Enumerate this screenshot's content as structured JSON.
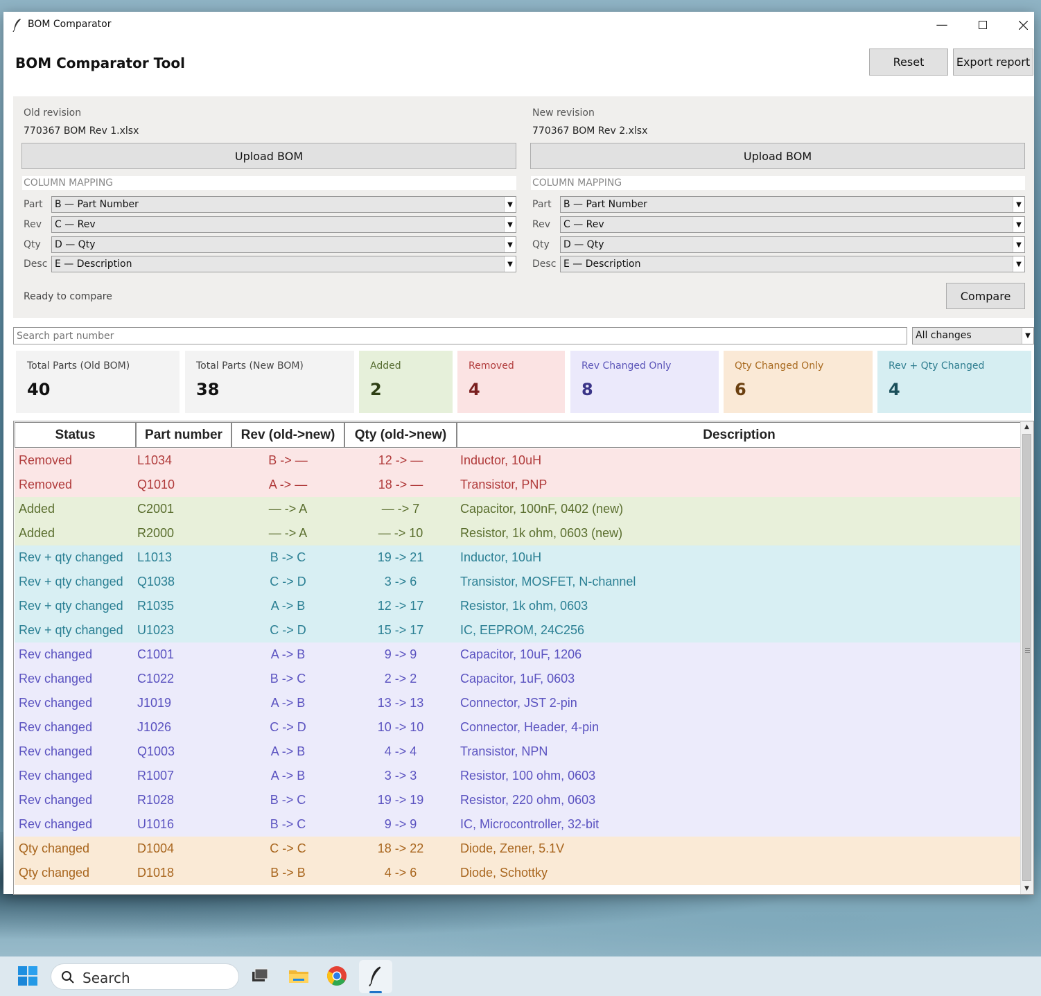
{
  "window": {
    "title": "BOM Comparator"
  },
  "header": {
    "app_title": "BOM Comparator Tool",
    "reset_label": "Reset",
    "export_label": "Export report"
  },
  "old": {
    "label": "Old revision",
    "file": "770367 BOM Rev 1.xlsx",
    "upload_label": "Upload BOM",
    "mapping_title": "COLUMN MAPPING",
    "mappings": [
      {
        "label": "Part",
        "value": "B — Part Number"
      },
      {
        "label": "Rev",
        "value": "C — Rev"
      },
      {
        "label": "Qty",
        "value": "D — Qty"
      },
      {
        "label": "Desc",
        "value": "E — Description"
      }
    ]
  },
  "new": {
    "label": "New revision",
    "file": "770367 BOM Rev 2.xlsx",
    "upload_label": "Upload BOM",
    "mapping_title": "COLUMN MAPPING",
    "mappings": [
      {
        "label": "Part",
        "value": "B — Part Number"
      },
      {
        "label": "Rev",
        "value": "C — Rev"
      },
      {
        "label": "Qty",
        "value": "D — Qty"
      },
      {
        "label": "Desc",
        "value": "E — Description"
      }
    ]
  },
  "status_text": "Ready to compare",
  "compare_label": "Compare",
  "search": {
    "placeholder": "Search part number"
  },
  "filter": {
    "value": "All changes"
  },
  "summary": [
    {
      "label": "Total Parts (Old BOM)",
      "value": "40",
      "bg": "#f3f3f3",
      "fg": "#444",
      "num": "#111"
    },
    {
      "label": "Total Parts (New BOM)",
      "value": "38",
      "bg": "#f3f3f3",
      "fg": "#444",
      "num": "#111"
    },
    {
      "label": "Added",
      "value": "2",
      "bg": "#e6f0da",
      "fg": "#556b2f",
      "num": "#2e3f14"
    },
    {
      "label": "Removed",
      "value": "4",
      "bg": "#fbe3e3",
      "fg": "#b03a3a",
      "num": "#7a1f1f"
    },
    {
      "label": "Rev Changed Only",
      "value": "8",
      "bg": "#ebe9fb",
      "fg": "#5a54b8",
      "num": "#3a3488"
    },
    {
      "label": "Qty Changed Only",
      "value": "6",
      "bg": "#fae9d6",
      "fg": "#a86a1f",
      "num": "#6b4010"
    },
    {
      "label": "Rev + Qty Changed",
      "value": "4",
      "bg": "#d6eef2",
      "fg": "#2e7d8f",
      "num": "#1a4f5a"
    }
  ],
  "table": {
    "headers": [
      "Status",
      "Part number",
      "Rev (old->new)",
      "Qty (old->new)",
      "Description"
    ],
    "rows": [
      [
        "Removed",
        "L1034",
        "B -> —",
        "12 -> —",
        "Inductor, 10uH"
      ],
      [
        "Removed",
        "Q1010",
        "A -> —",
        "18 -> —",
        "Transistor, PNP"
      ],
      [
        "Added",
        "C2001",
        "— -> A",
        "— -> 7",
        "Capacitor, 100nF, 0402 (new)"
      ],
      [
        "Added",
        "R2000",
        "— -> A",
        "— -> 10",
        "Resistor, 1k ohm, 0603 (new)"
      ],
      [
        "Rev + qty changed",
        "L1013",
        "B -> C",
        "19 -> 21",
        "Inductor, 10uH"
      ],
      [
        "Rev + qty changed",
        "Q1038",
        "C -> D",
        "3 -> 6",
        "Transistor, MOSFET, N-channel"
      ],
      [
        "Rev + qty changed",
        "R1035",
        "A -> B",
        "12 -> 17",
        "Resistor, 1k ohm, 0603"
      ],
      [
        "Rev + qty changed",
        "U1023",
        "C -> D",
        "15 -> 17",
        "IC, EEPROM, 24C256"
      ],
      [
        "Rev changed",
        "C1001",
        "A -> B",
        "9 -> 9",
        "Capacitor, 10uF, 1206"
      ],
      [
        "Rev changed",
        "C1022",
        "B -> C",
        "2 -> 2",
        "Capacitor, 1uF, 0603"
      ],
      [
        "Rev changed",
        "J1019",
        "A -> B",
        "13 -> 13",
        "Connector, JST 2-pin"
      ],
      [
        "Rev changed",
        "J1026",
        "C -> D",
        "10 -> 10",
        "Connector, Header, 4-pin"
      ],
      [
        "Rev changed",
        "Q1003",
        "A -> B",
        "4 -> 4",
        "Transistor, NPN"
      ],
      [
        "Rev changed",
        "R1007",
        "A -> B",
        "3 -> 3",
        "Resistor, 100 ohm, 0603"
      ],
      [
        "Rev changed",
        "R1028",
        "B -> C",
        "19 -> 19",
        "Resistor, 220 ohm, 0603"
      ],
      [
        "Rev changed",
        "U1016",
        "B -> C",
        "9 -> 9",
        "IC, Microcontroller, 32-bit"
      ],
      [
        "Qty changed",
        "D1004",
        "C -> C",
        "18 -> 22",
        "Diode, Zener, 5.1V"
      ],
      [
        "Qty changed",
        "D1018",
        "B -> B",
        "4 -> 6",
        "Diode, Schottky"
      ]
    ]
  },
  "row_colors": {
    "Removed": {
      "bg": "#fbe6e6",
      "fg": "#b03a3a"
    },
    "Added": {
      "bg": "#e8f0da",
      "fg": "#5a6e2e"
    },
    "Rev + qty changed": {
      "bg": "#d8eff3",
      "fg": "#2a7f93"
    },
    "Rev changed": {
      "bg": "#ecebfb",
      "fg": "#5a52c0"
    },
    "Qty changed": {
      "bg": "#faead6",
      "fg": "#a8651d"
    }
  },
  "taskbar": {
    "search_label": "Search"
  }
}
